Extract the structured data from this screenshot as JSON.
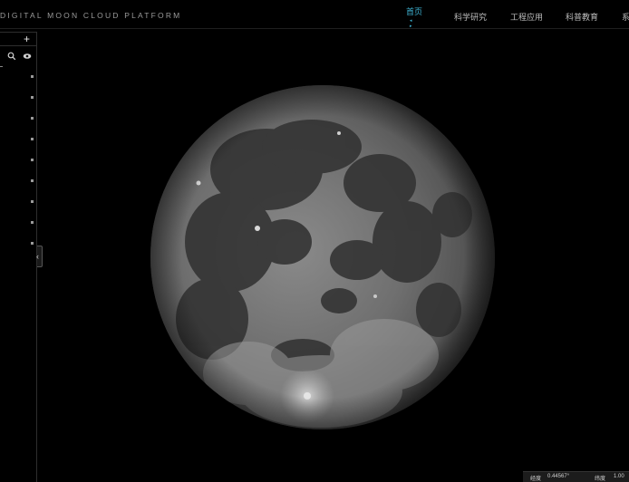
{
  "header": {
    "brand": "DIGITAL MOON CLOUD PLATFORM",
    "nav": [
      {
        "label": "首页",
        "active": true,
        "marker": "◂ ▸"
      },
      {
        "label": "科学研究"
      },
      {
        "label": "工程应用"
      },
      {
        "label": "科普教育"
      },
      {
        "label": "系"
      }
    ]
  },
  "sidebar": {
    "add_icon": "plus-icon",
    "tools": [
      "search-icon",
      "eye-icon"
    ],
    "item_count": 9,
    "collapse_icon": "chevron-left-icon",
    "collapse_glyph": "‹"
  },
  "moon": {
    "icon": "moon-globe"
  },
  "status": {
    "lon_label": "经度",
    "lon_value": "0.44567°",
    "lat_label": "纬度",
    "lat_value": "1.00"
  },
  "colors": {
    "accent": "#3fb6d6",
    "background": "#000000"
  }
}
